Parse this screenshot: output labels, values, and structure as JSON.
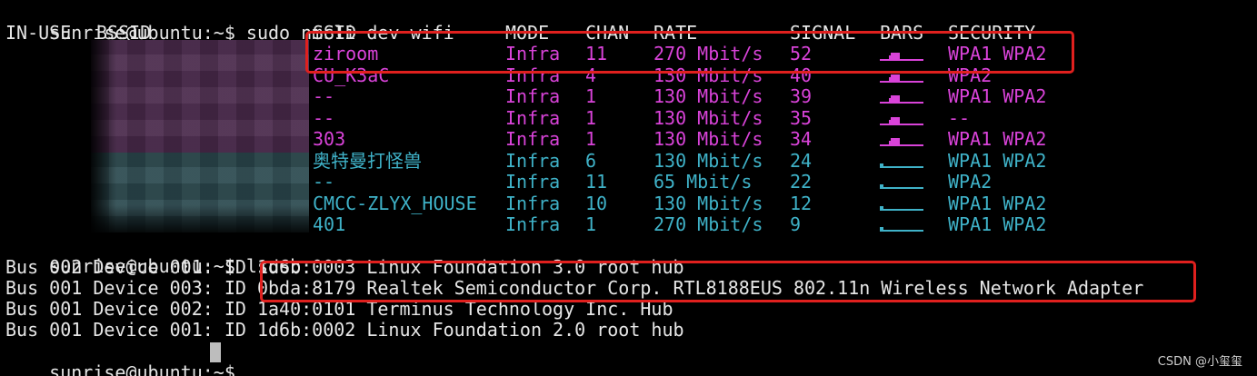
{
  "terminal": {
    "prompt": "sunrise@ubuntu:~$",
    "command1": "sudo nmcli dev wifi",
    "command2": "lsusb",
    "cursor": "█"
  },
  "wifi_table": {
    "headers": {
      "in_use": "IN-USE",
      "bssid": "BSSID",
      "ssid": "SSID",
      "mode": "MODE",
      "chan": "CHAN",
      "rate": "RATE",
      "signal": "SIGNAL",
      "bars": "BARS",
      "security": "SECURITY"
    },
    "rows": [
      {
        "ssid": "ziroom",
        "mode": "Infra",
        "chan": "11",
        "rate": "270 Mbit/s",
        "signal": "52",
        "bars_level": 2,
        "security": "WPA1 WPA2",
        "color": "#d943d9"
      },
      {
        "ssid": "CU_K3aC",
        "mode": "Infra",
        "chan": "4",
        "rate": "130 Mbit/s",
        "signal": "40",
        "bars_level": 2,
        "security": "WPA2",
        "color": "#d943d9"
      },
      {
        "ssid": "--",
        "mode": "Infra",
        "chan": "1",
        "rate": "130 Mbit/s",
        "signal": "39",
        "bars_level": 2,
        "security": "WPA1 WPA2",
        "color": "#d943d9"
      },
      {
        "ssid": "--",
        "mode": "Infra",
        "chan": "1",
        "rate": "130 Mbit/s",
        "signal": "35",
        "bars_level": 2,
        "security": "--",
        "color": "#d943d9"
      },
      {
        "ssid": "303",
        "mode": "Infra",
        "chan": "1",
        "rate": "130 Mbit/s",
        "signal": "34",
        "bars_level": 2,
        "security": "WPA1 WPA2",
        "color": "#d943d9"
      },
      {
        "ssid": "奥特曼打怪兽",
        "mode": "Infra",
        "chan": "6",
        "rate": "130 Mbit/s",
        "signal": "24",
        "bars_level": 1,
        "security": "WPA1 WPA2",
        "color": "#3fb2c8"
      },
      {
        "ssid": "--",
        "mode": "Infra",
        "chan": "11",
        "rate": "65 Mbit/s",
        "signal": "22",
        "bars_level": 1,
        "security": "WPA2",
        "color": "#3fb2c8"
      },
      {
        "ssid": "CMCC-ZLYX_HOUSE",
        "mode": "Infra",
        "chan": "10",
        "rate": "130 Mbit/s",
        "signal": "12",
        "bars_level": 1,
        "security": "WPA1 WPA2",
        "color": "#3fb2c8"
      },
      {
        "ssid": "401",
        "mode": "Infra",
        "chan": "1",
        "rate": "270 Mbit/s",
        "signal": "9",
        "bars_level": 1,
        "security": "WPA1 WPA2",
        "color": "#3fb2c8"
      }
    ]
  },
  "lsusb": {
    "lines": [
      "Bus 002 Device 001: ID 1d6b:0003 Linux Foundation 3.0 root hub",
      "Bus 001 Device 003: ID 0bda:8179 Realtek Semiconductor Corp. RTL8188EUS 802.11n Wireless Network Adapter",
      "Bus 001 Device 002: ID 1a40:0101 Terminus Technology Inc. Hub",
      "Bus 001 Device 001: ID 1d6b:0002 Linux Foundation 2.0 root hub"
    ]
  },
  "watermark": "CSDN @小玺玺",
  "colors": {
    "background": "#000000",
    "text": "#e6e6e6",
    "strong_signal": "#d943d9",
    "weak_signal": "#3fb2c8",
    "highlight": "#e0201e"
  }
}
